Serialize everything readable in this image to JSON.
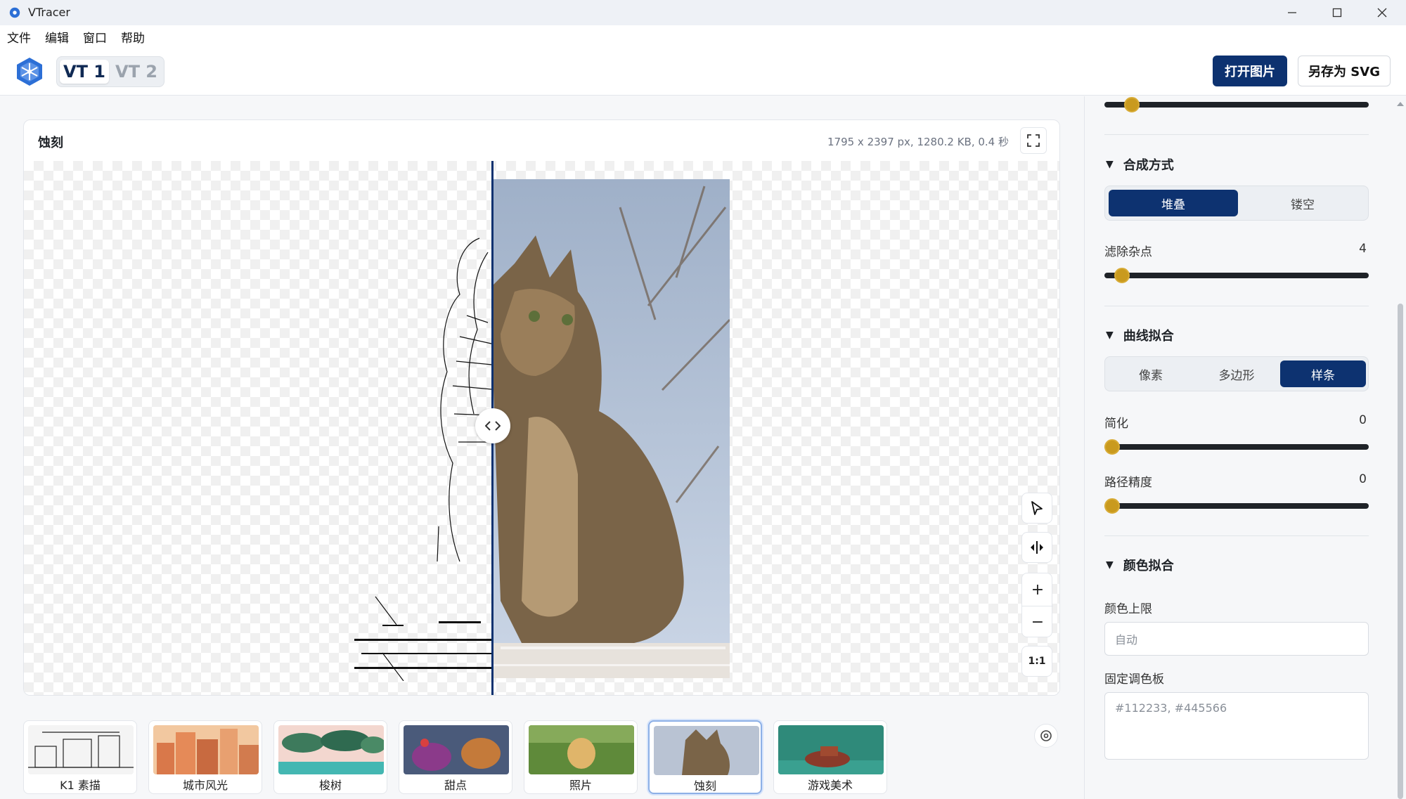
{
  "window": {
    "title": "VTracer"
  },
  "menu": {
    "items": [
      "文件",
      "编辑",
      "窗口",
      "帮助"
    ]
  },
  "toolbar": {
    "tabs": [
      "VT 1",
      "VT 2"
    ],
    "active_tab": "VT 1",
    "open_label": "打开图片",
    "save_label": "另存为 SVG"
  },
  "preview": {
    "title": "蚀刻",
    "meta": "1795 x 2397 px, 1280.2 KB, 0.4 秒",
    "zoom_reset_label": "1:1"
  },
  "thumbnails": [
    {
      "label": "K1 素描",
      "selected": false
    },
    {
      "label": "城市风光",
      "selected": false
    },
    {
      "label": "梭树",
      "selected": false
    },
    {
      "label": "甜点",
      "selected": false
    },
    {
      "label": "照片",
      "selected": false
    },
    {
      "label": "蚀刻",
      "selected": true
    },
    {
      "label": "游戏美术",
      "selected": false
    }
  ],
  "settings": {
    "top_slider_level": 0.08,
    "composition": {
      "title": "合成方式",
      "options": [
        "堆叠",
        "镂空"
      ],
      "selected": "堆叠"
    },
    "filter_speckle": {
      "label": "滤除杂点",
      "value": "4",
      "level": 0.04
    },
    "curve_fitting": {
      "title": "曲线拟合",
      "options": [
        "像素",
        "多边形",
        "样条"
      ],
      "selected": "样条"
    },
    "simplify": {
      "label": "简化",
      "value": "0",
      "level": 0
    },
    "path_precision": {
      "label": "路径精度",
      "value": "0",
      "level": 0
    },
    "color_fitting": {
      "title": "颜色拟合"
    },
    "color_limit": {
      "label": "颜色上限",
      "placeholder": "自动"
    },
    "fixed_palette": {
      "label": "固定调色板",
      "placeholder": "#112233, #445566"
    }
  },
  "colors": {
    "primary": "#0d3270",
    "knob": "#c99a1e",
    "track": "#1f2328"
  }
}
